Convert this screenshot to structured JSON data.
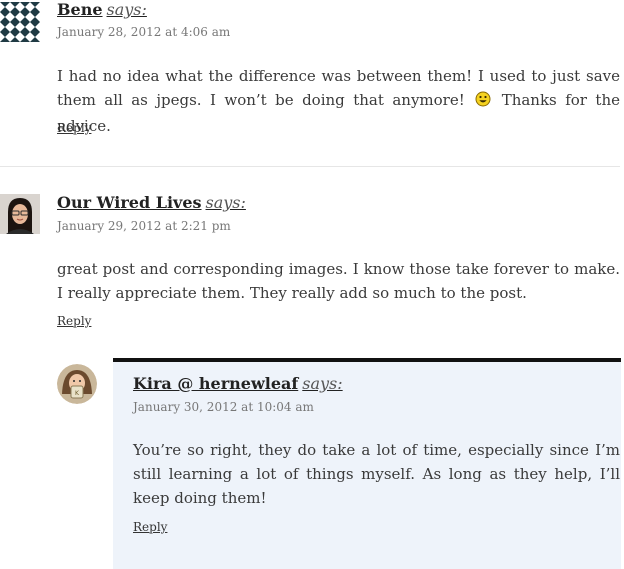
{
  "comments": [
    {
      "author": "Bene",
      "says": "says:",
      "date": "January 28, 2012 at 4:06 am",
      "text_before": "I had no idea what the difference was between them! I used to just save them all as jpegs. I won’t be doing that anymore!",
      "text_after": "Thanks for the advice.",
      "reply": "Reply",
      "avatar_icon": "pattern-avatar",
      "emoji_icon": "smiley-face-icon"
    },
    {
      "author": "Our Wired Lives",
      "says": "says:",
      "date": "January 29, 2012 at 2:21 pm",
      "text": "great post and corresponding images. I know those take forever to make. I really appreciate them. They really add so much to the post.",
      "reply": "Reply",
      "avatar_icon": "woman-portrait-avatar"
    },
    {
      "author": "Kira @ hernewleaf",
      "says": "says:",
      "date": "January 30, 2012 at 10:04 am",
      "text": "You’re so right, they do take a lot of time, especially since I’m still learning a lot of things myself. As long as they help, I’ll keep doing them!",
      "reply": "Reply",
      "avatar_icon": "woman-with-mug-avatar"
    }
  ],
  "colors": {
    "author_highlight_bg": "#eef3fa",
    "author_highlight_border": "#111111",
    "divider": "#e6e6e6"
  }
}
